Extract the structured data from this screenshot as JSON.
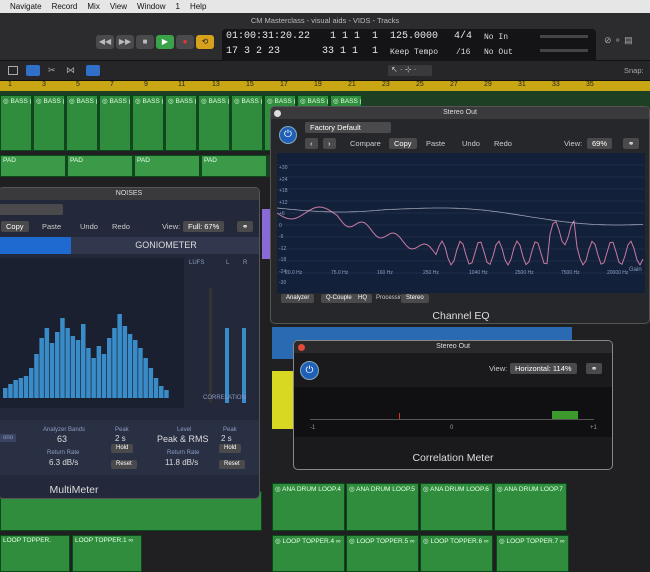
{
  "menubar": {
    "items": [
      "Navigate",
      "Record",
      "Mix",
      "View",
      "Window",
      "1",
      "Help"
    ]
  },
  "window": {
    "title": "CM Masterclass - visual aids - VIDS - Tracks"
  },
  "lcd": {
    "time": "01:00:31:20.22",
    "time_bar": "1  1  1",
    "time_tick": "1",
    "tempo": "125.0000",
    "sig": "4/4",
    "in": "No In",
    "bars": "17  3  2  23",
    "bars2": "33  1  1",
    "bars2_tick": "1",
    "keep": "Keep Tempo",
    "div": "/16",
    "out": "No Out"
  },
  "toolbar": {
    "snap": "Snap:"
  },
  "ruler": {
    "marks": [
      "1",
      "3",
      "5",
      "7",
      "9",
      "11",
      "13",
      "15",
      "17",
      "19",
      "21",
      "23",
      "25",
      "27",
      "29",
      "31",
      "33",
      "35"
    ]
  },
  "tracks": {
    "bass_label": "◎ BASS (-1",
    "pad_label": "PAD",
    "drum_labels": [
      "◎ ANA DRUM LOOP.4",
      "◎ ANA DRUM LOOP.5",
      "◎ ANA DRUM LOOP.6",
      "◎ ANA DRUM LOOP.7"
    ],
    "topper_labels": [
      "LOOP TOPPER.",
      "LOOP TOPPER.1 ∞",
      "◎ LOOP TOPPER.4 ∞",
      "◎ LOOP TOPPER.5 ∞",
      "◎ LOOP TOPPER.6 ∞",
      "◎ LOOP TOPPER.7 ∞"
    ]
  },
  "eq": {
    "title": "Stereo Out",
    "preset": "Factory Default",
    "compare": "Compare",
    "copy": "Copy",
    "paste": "Paste",
    "undo": "Undo",
    "redo": "Redo",
    "view_label": "View:",
    "view_value": "69%",
    "name": "Channel EQ",
    "analyzer": "Analyzer",
    "q_couple": "Q-Couple",
    "hq": "HQ",
    "processing": "Processing",
    "processing_value": "Stereo",
    "gain": "Gain",
    "db_labels": [
      "+30",
      "+24",
      "+18",
      "+12",
      "+6",
      "0",
      "-6",
      "-12",
      "-18",
      "-24",
      "-30"
    ],
    "freqs": [
      "20.0 Hz",
      "75.0 Hz",
      "160 Hz",
      "250 Hz",
      "1040 Hz",
      "2500 Hz",
      "7500 Hz",
      "20000 Hz"
    ]
  },
  "multimeter": {
    "title": "NOISES",
    "copy": "Copy",
    "paste": "Paste",
    "undo": "Undo",
    "redo": "Redo",
    "view_label": "View:",
    "view_value": "Full: 67%",
    "goniometer": "GONIOMETER",
    "lufs": "LUFS",
    "l": "L",
    "r": "R",
    "analyzer_bands": "Analyzer Bands",
    "bands_value": "63",
    "return_rate": "Return Rate",
    "return_value": "6.3 dB/s",
    "peak": "Peak",
    "peak_value": "2 s",
    "hold": "Hold",
    "reset": "Reset",
    "level": "Level",
    "level_value": "Peak & RMS",
    "level_rate": "Return Rate",
    "level_rate_value": "11.8 dB/s",
    "peak2": "Peak",
    "peak2_value": "2 s",
    "correlation": "CORRELATION",
    "name": "MultiMeter",
    "mono": "ono"
  },
  "corr": {
    "title": "Stereo Out",
    "view_label": "View:",
    "view_value": "Horizontal: 114%",
    "left": "-1",
    "mid": "0",
    "right": "+1",
    "name": "Correlation Meter"
  }
}
